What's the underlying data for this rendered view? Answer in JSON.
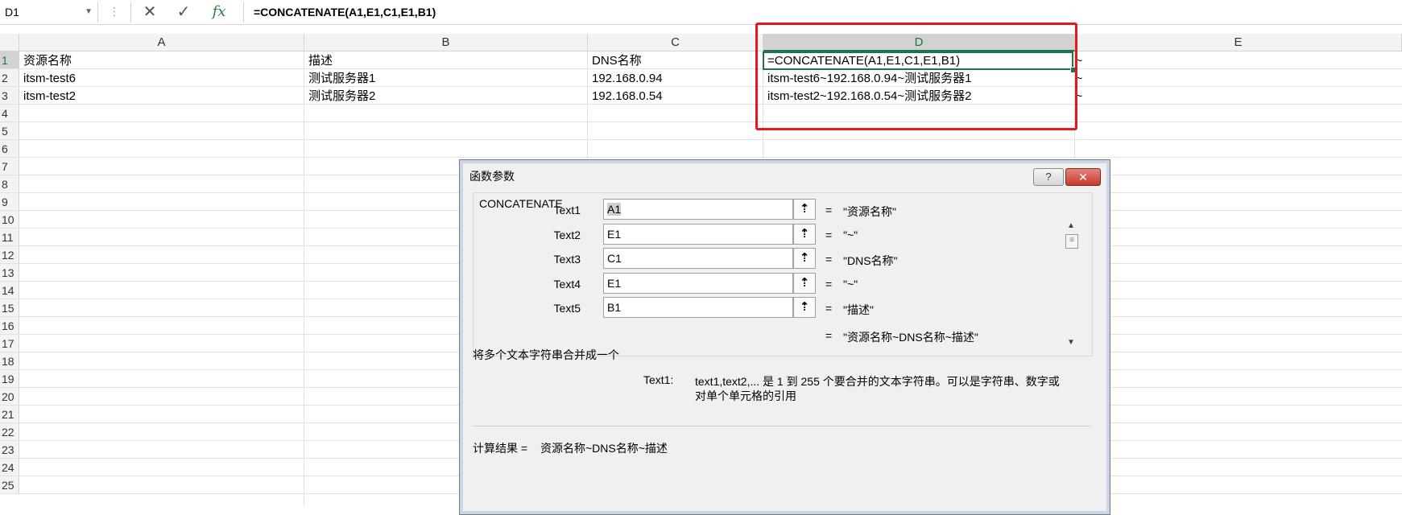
{
  "formula_bar": {
    "name_box": "D1",
    "cancel_icon": "✕",
    "enter_icon": "✓",
    "fx_label": "fx",
    "formula": "=CONCATENATE(A1,E1,C1,E1,B1)"
  },
  "columns": [
    "A",
    "B",
    "C",
    "D",
    "E"
  ],
  "rows": [
    "1",
    "2",
    "3",
    "4",
    "5",
    "6",
    "7",
    "8",
    "9",
    "10",
    "11",
    "12",
    "13",
    "14",
    "15",
    "16",
    "17",
    "18",
    "19",
    "20",
    "21",
    "22",
    "23",
    "24",
    "25"
  ],
  "cells": {
    "A1": "资源名称",
    "B1": "描述",
    "C1": "DNS名称",
    "D1": "=CONCATENATE(A1,E1,C1,E1,B1)",
    "E1": "~",
    "A2": "itsm-test6",
    "B2": "测试服务器1",
    "C2": "192.168.0.94",
    "D2": "itsm-test6~192.168.0.94~测试服务器1",
    "E2": "~",
    "A3": "itsm-test2",
    "B3": "测试服务器2",
    "C3": "192.168.0.54",
    "D3": "itsm-test2~192.168.0.54~测试服务器2",
    "E3": "~"
  },
  "dialog": {
    "title": "函数参数",
    "help_label": "?",
    "close_label": "✕",
    "function_name": "CONCATENATE",
    "args": [
      {
        "label": "Text1",
        "value": "A1",
        "result": "\"资源名称\""
      },
      {
        "label": "Text2",
        "value": "E1",
        "result": "\"~\""
      },
      {
        "label": "Text3",
        "value": "C1",
        "result": "\"DNS名称\""
      },
      {
        "label": "Text4",
        "value": "E1",
        "result": "\"~\""
      },
      {
        "label": "Text5",
        "value": "B1",
        "result": "\"描述\""
      }
    ],
    "equals": "=",
    "overall_result": "\"资源名称~DNS名称~描述\"",
    "description": "将多个文本字符串合并成一个",
    "arg_help_label": "Text1:",
    "arg_help_line1": "text1,text2,... 是 1 到 255 个要合并的文本字符串。可以是字符串、数字或",
    "arg_help_line2": "对单个单元格的引用",
    "calc_result_label": "计算结果 =",
    "calc_result_value": "资源名称~DNS名称~描述"
  }
}
